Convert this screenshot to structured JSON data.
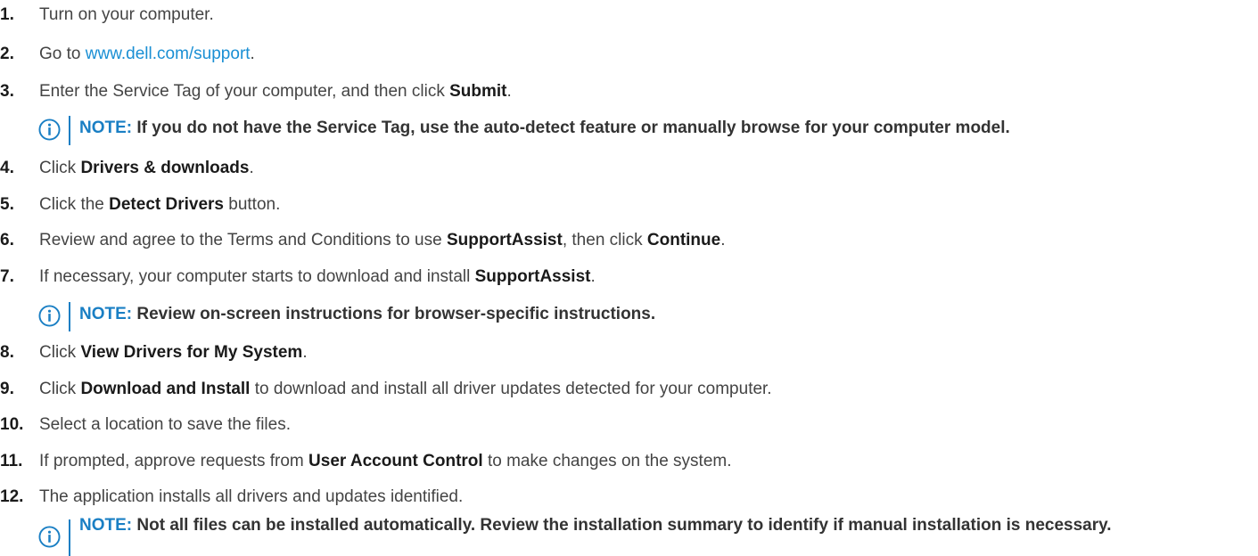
{
  "steps": [
    {
      "num": "1.",
      "pre": "Turn on your computer.",
      "bold": "",
      "post": "",
      "bold2": "",
      "post2": ""
    },
    {
      "num": "2.",
      "pre": "Go to ",
      "link": "www.dell.com/support",
      "post": "."
    },
    {
      "num": "3.",
      "pre": "Enter the Service Tag of your computer, and then click ",
      "bold": "Submit",
      "post": "."
    },
    {
      "num": "4.",
      "pre": "Click ",
      "bold": "Drivers & downloads",
      "post": "."
    },
    {
      "num": "5.",
      "pre": "Click the ",
      "bold": "Detect Drivers",
      "post": " button."
    },
    {
      "num": "6.",
      "pre": "Review and agree to the Terms and Conditions to use ",
      "bold": "SupportAssist",
      "post": ", then click ",
      "bold2": "Continue",
      "post2": "."
    },
    {
      "num": "7.",
      "pre": "If necessary, your computer starts to download and install ",
      "bold": "SupportAssist",
      "post": "."
    },
    {
      "num": "8.",
      "pre": "Click ",
      "bold": "View Drivers for My System",
      "post": "."
    },
    {
      "num": "9.",
      "pre": "Click ",
      "bold": "Download and Install",
      "post": " to download and install all driver updates detected for your computer."
    },
    {
      "num": "10.",
      "pre": "Select a location to save the files.",
      "bold": "",
      "post": ""
    },
    {
      "num": "11.",
      "pre": "If prompted, approve requests from ",
      "bold": "User Account Control",
      "post": " to make changes on the system."
    },
    {
      "num": "12.",
      "pre": "The application installs all drivers and updates identified.",
      "bold": "",
      "post": ""
    }
  ],
  "notes": [
    {
      "label": "NOTE:",
      "text": " If you do not have the Service Tag, use the auto-detect feature or manually browse for your computer model."
    },
    {
      "label": "NOTE:",
      "text": " Review on-screen instructions for browser-specific instructions."
    },
    {
      "label": "NOTE:",
      "text": " Not all files can be installed automatically. Review the installation summary to identify if manual installation is necessary."
    }
  ],
  "colors": {
    "link": "#1a8fd4",
    "note_accent": "#1a7fc4"
  },
  "icons": {
    "note": "info-circle-icon"
  }
}
